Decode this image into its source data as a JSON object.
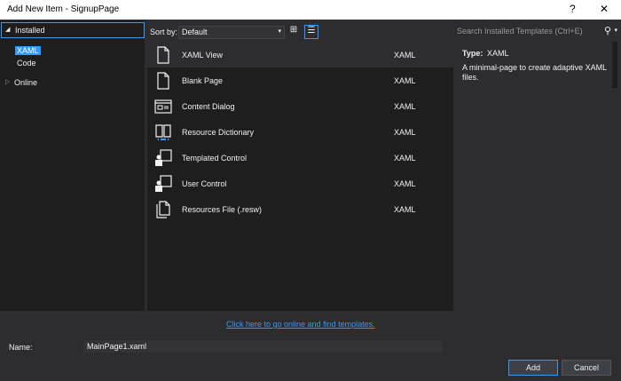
{
  "window": {
    "title": "Add New Item - SignupPage",
    "help": "?",
    "close": "✕"
  },
  "tree": {
    "installed": "Installed",
    "xaml": "XAML",
    "code": "Code",
    "online": "Online"
  },
  "toolbar": {
    "sort_label": "Sort by:",
    "sort_value": "Default"
  },
  "search": {
    "placeholder": "Search Installed Templates (Ctrl+E)"
  },
  "templates": [
    {
      "name": "XAML View",
      "type": "XAML",
      "icon": "xaml-view-icon"
    },
    {
      "name": "Blank Page",
      "type": "XAML",
      "icon": "blank-page-icon"
    },
    {
      "name": "Content Dialog",
      "type": "XAML",
      "icon": "content-dialog-icon"
    },
    {
      "name": "Resource Dictionary",
      "type": "XAML",
      "icon": "resource-dictionary-icon"
    },
    {
      "name": "Templated Control",
      "type": "XAML",
      "icon": "templated-control-icon"
    },
    {
      "name": "User Control",
      "type": "XAML",
      "icon": "user-control-icon"
    },
    {
      "name": "Resources File (.resw)",
      "type": "XAML",
      "icon": "resources-file-icon"
    }
  ],
  "details": {
    "type_label": "Type:",
    "type_value": "XAML",
    "description": "A minimal-page to create adaptive XAML files."
  },
  "online_link": "Click here to go online and find templates.",
  "name_field": {
    "label": "Name:",
    "value": "MainPage1.xaml"
  },
  "buttons": {
    "add": "Add",
    "cancel": "Cancel"
  },
  "colors": {
    "accent": "#3399ff",
    "background": "#2d2d30",
    "panel": "#1e1e1e"
  }
}
